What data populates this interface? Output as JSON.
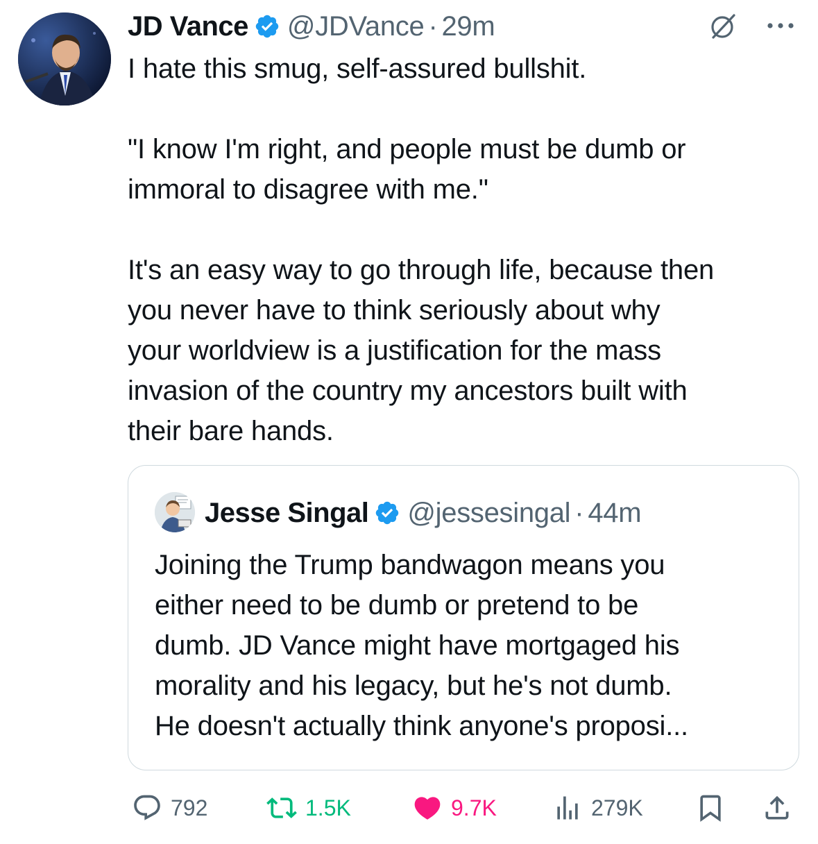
{
  "tweet": {
    "author": {
      "name": "JD Vance",
      "handle": "@JDVance",
      "verified": true
    },
    "separator": "·",
    "time": "29m",
    "text_paragraphs": [
      [
        "I hate this smug, self-assured bullshit."
      ],
      [
        "\"I know I'm right, and people must be dumb or",
        "immoral to disagree with me.\""
      ],
      [
        "It's an easy way to go through life, because then",
        "you never have to think seriously about why",
        "your worldview is a justification for the mass",
        "invasion of the country my ancestors built with",
        "their bare hands."
      ]
    ]
  },
  "quoted_tweet": {
    "author": {
      "name": "Jesse Singal",
      "handle": "@jessesingal",
      "verified": true
    },
    "separator": "·",
    "time": "44m",
    "text_lines": [
      "Joining the Trump bandwagon means you",
      "either need to be dumb or pretend to be",
      "dumb. JD Vance might have mortgaged his",
      "morality and his legacy, but he's not dumb.",
      "He doesn't actually think anyone's proposi..."
    ]
  },
  "actions": {
    "replies": "792",
    "reposts": "1.5K",
    "likes": "9.7K",
    "views": "279K"
  },
  "colors": {
    "verified_blue": "#1d9bf0",
    "repost_green": "#00ba7c",
    "like_pink": "#f91880",
    "secondary_text": "#536471",
    "border": "#cfd9de"
  },
  "icons": [
    "verified-badge-icon",
    "grok-icon",
    "more-icon",
    "reply-icon",
    "repost-icon",
    "like-icon",
    "views-icon",
    "bookmark-icon",
    "share-icon"
  ]
}
